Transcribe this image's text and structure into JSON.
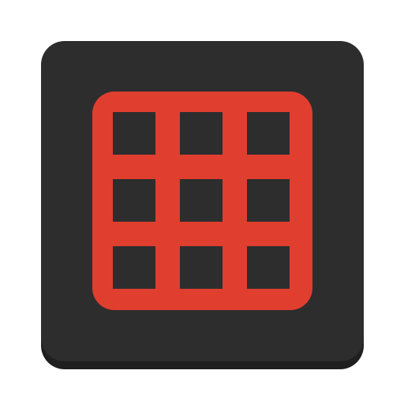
{
  "icon": {
    "name": "grid-icon",
    "tile_color": "#2d2d2d",
    "tile_shadow_color": "#1f1f1f",
    "grid_color": "#e03e2f",
    "grid_rows": 3,
    "grid_columns": 3
  }
}
